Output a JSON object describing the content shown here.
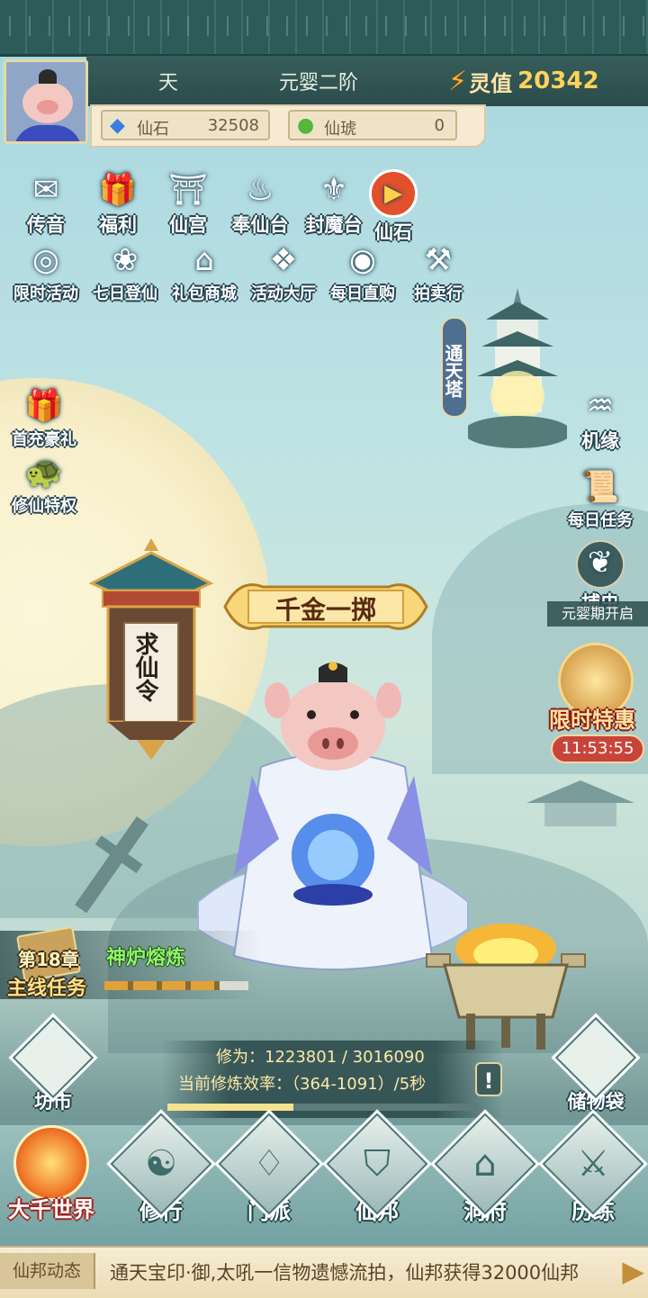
{
  "header": {
    "realm_char": "天",
    "cultivation_stage": "元婴二阶",
    "spirit_value_label": "灵值",
    "spirit_value": "20342"
  },
  "resources": [
    {
      "name": "仙石",
      "value": "32508",
      "icon": "blue-gem-icon",
      "color": "#3a7de0"
    },
    {
      "name": "仙琥",
      "value": "0",
      "icon": "green-jade-icon",
      "color": "#58b63a"
    }
  ],
  "top_row_1": [
    {
      "label": "传音",
      "icon": "envelope-icon"
    },
    {
      "label": "福利",
      "icon": "gift-icon"
    },
    {
      "label": "仙宫",
      "icon": "palace-icon"
    },
    {
      "label": "奉仙台",
      "icon": "altar-icon"
    },
    {
      "label": "封魔台",
      "icon": "demon-seal-icon"
    },
    {
      "label": "仙石",
      "icon": "video-play-icon"
    }
  ],
  "top_row_2": [
    {
      "label": "限时活动",
      "icon": "timed-event-icon"
    },
    {
      "label": "七日登仙",
      "icon": "lotus-icon"
    },
    {
      "label": "礼包商城",
      "icon": "shop-icon"
    },
    {
      "label": "活动大厅",
      "icon": "hall-icon"
    },
    {
      "label": "每日直购",
      "icon": "coin-icon"
    },
    {
      "label": "拍卖行",
      "icon": "gavel-icon"
    }
  ],
  "left_side": [
    {
      "label": "首充豪礼",
      "icon": "gift-box-icon"
    },
    {
      "label": "修仙特权",
      "icon": "turtle-icon"
    }
  ],
  "right_side": {
    "tower_label": "通天塔",
    "items": [
      {
        "label": "机缘",
        "icon": "fortune-icon"
      },
      {
        "label": "每日任务",
        "icon": "scroll-icon"
      },
      {
        "label": "捕虫",
        "icon": "butterfly-icon"
      }
    ],
    "nascent_notice": "元婴期开启",
    "limited_sale": "限时特惠",
    "limited_timer": "11:53:55"
  },
  "events": {
    "banner": "千金一掷",
    "lantern": "求仙令"
  },
  "quest": {
    "chapter": "第18章",
    "label": "主线任务",
    "furnace_label": "神炉熔炼",
    "furnace_progress": 0.8
  },
  "cultivation": {
    "progress_text": "修为：1223801 / 3016090",
    "efficiency_text": "当前修炼效率：（364-1091）/5秒",
    "progress": 0.405,
    "alert_icon": "exclamation-icon"
  },
  "side_buttons": [
    {
      "label": "坊市",
      "icon": "market-icon"
    },
    {
      "label": "储物袋",
      "icon": "bag-icon"
    }
  ],
  "bottom_nav": [
    {
      "label": "大千世界",
      "icon": "world-swirl-icon",
      "active": true
    },
    {
      "label": "修行",
      "icon": "taiji-icon"
    },
    {
      "label": "门派",
      "icon": "sect-icon"
    },
    {
      "label": "仙邦",
      "icon": "shield-icon"
    },
    {
      "label": "洞府",
      "icon": "cave-house-icon"
    },
    {
      "label": "历练",
      "icon": "sword-icon"
    }
  ],
  "ticker": {
    "title": "仙邦动态",
    "message": "通天宝印·御,太吼一信物遗憾流拍，仙邦获得32000仙邦",
    "next_icon": "arrow-right-icon"
  }
}
